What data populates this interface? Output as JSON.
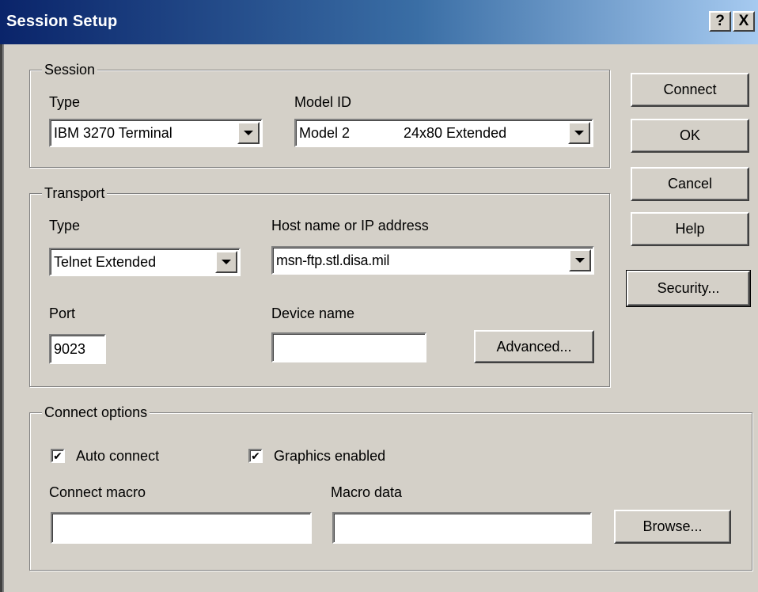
{
  "window": {
    "title": "Session Setup",
    "help_button": "?",
    "close_button": "X"
  },
  "session": {
    "legend": "Session",
    "type_label": "Type",
    "type_value": "IBM 3270 Terminal",
    "model_label": "Model ID",
    "model_value": "Model 2",
    "model_value_extra": "24x80 Extended"
  },
  "transport": {
    "legend": "Transport",
    "type_label": "Type",
    "type_value": "Telnet Extended",
    "host_label": "Host name or IP address",
    "host_value": "msn-ftp.stl.disa.mil",
    "port_label": "Port",
    "port_value": "9023",
    "device_label": "Device name",
    "device_value": "",
    "advanced_button": "Advanced..."
  },
  "connect_options": {
    "legend": "Connect options",
    "auto_connect_label": "Auto connect",
    "auto_connect_checked": true,
    "graphics_label": "Graphics enabled",
    "graphics_checked": true,
    "macro_label": "Connect macro",
    "macro_value": "",
    "macro_data_label": "Macro data",
    "macro_data_value": "",
    "browse_button": "Browse..."
  },
  "buttons": {
    "connect": "Connect",
    "ok": "OK",
    "cancel": "Cancel",
    "help": "Help",
    "security": "Security..."
  },
  "icons": {
    "check": "✔"
  },
  "colors": {
    "title_bar_start": "#0a246a",
    "title_bar_end": "#a6caf0",
    "dialog_face": "#d4d0c8"
  }
}
